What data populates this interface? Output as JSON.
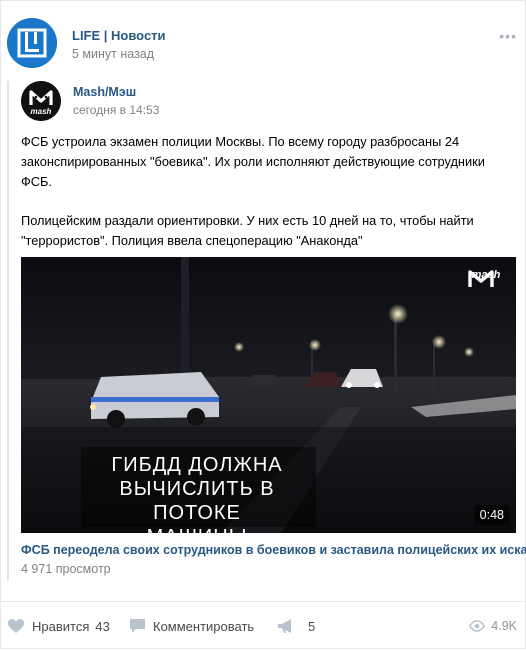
{
  "post": {
    "author": "LIFE | Новости",
    "time": "5 минут назад",
    "menu_glyph": "•••"
  },
  "repost": {
    "author": "Mash/Мэш",
    "time": "сегодня в 14:53",
    "paragraphs": [
      "ФСБ устроила экзамен полиции Москвы. По всему городу разбросаны 24 законспирированных \"боевика\". Их роли исполняют действующие сотрудники ФСБ.",
      "Полицейским раздали ориентировки. У них есть 10 дней на то, чтобы найти \"террористов\". Полиция ввела спецоперацию \"Анаконда\""
    ],
    "video": {
      "caption_lines": [
        "ГИБДД ДОЛЖНА",
        "ВЫЧИСЛИТЬ В ПОТОКЕ",
        "МАШИНЫ \"БОЕВИКОВ\""
      ],
      "badge_text": "mash",
      "duration": "0:48"
    },
    "link_title": "ФСБ переодела своих сотрудников в боевиков и заставила полицейских их искать",
    "views": "4 971 просмотр"
  },
  "footer": {
    "like_label": "Нравится",
    "like_count": "43",
    "comment_label": "Комментировать",
    "share_count": "5",
    "views": "4.9K"
  },
  "icons": {
    "like": "heart-icon",
    "comment": "comment-icon",
    "share": "megaphone-icon",
    "views": "eye-icon"
  },
  "colors": {
    "link": "#2a5885",
    "muted": "#828282",
    "life_brand": "#1a77c9"
  }
}
